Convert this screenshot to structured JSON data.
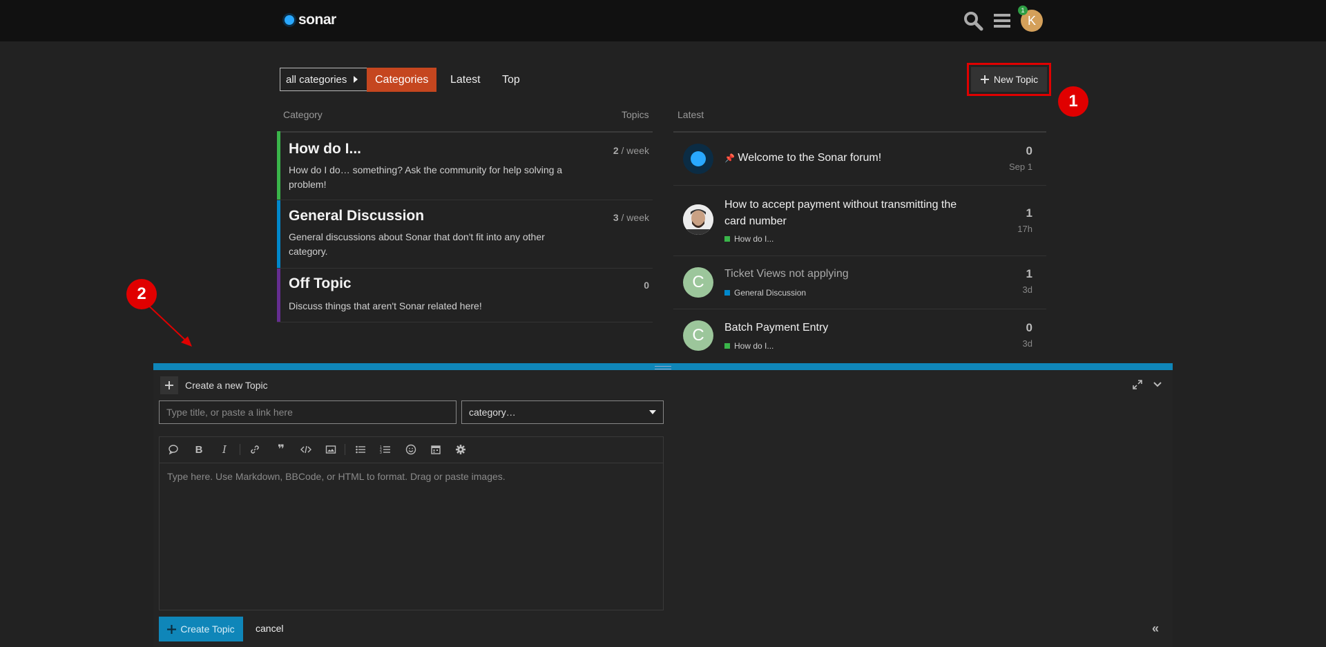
{
  "header": {
    "logo_text": "sonar",
    "avatar_letter": "K",
    "notification_count": "1",
    "icons": [
      "search-icon",
      "hamburger-menu-icon"
    ]
  },
  "nav": {
    "category_dropdown": "all categories",
    "tabs": [
      "Categories",
      "Latest",
      "Top"
    ],
    "new_topic_label": "New Topic"
  },
  "annotations": {
    "one": "1",
    "two": "2"
  },
  "categories_table": {
    "col_category": "Category",
    "col_topics": "Topics",
    "rows": [
      {
        "title": "How do I...",
        "description": "How do I do… something? Ask the community for help solving a problem!",
        "count": "2",
        "unit": " / week",
        "color": "#3ab54a"
      },
      {
        "title": "General Discussion",
        "description": "General discussions about Sonar that don't fit into any other category.",
        "count": "3",
        "unit": " / week",
        "color": "#0088cc"
      },
      {
        "title": "Off Topic",
        "description": "Discuss things that aren't Sonar related here!",
        "count": "0",
        "unit": "",
        "color": "#652d90"
      }
    ]
  },
  "latest": {
    "col_latest": "Latest",
    "topics": [
      {
        "title": "Welcome to the Sonar forum!",
        "pinned": true,
        "category": "",
        "count": "0",
        "time": "Sep 1"
      },
      {
        "title": "How to accept payment without transmitting the card number",
        "category": "How do I...",
        "category_color": "#3ab54a",
        "count": "1",
        "time": "17h"
      },
      {
        "title": "Ticket Views not applying",
        "category": "General Discussion",
        "category_color": "#0088cc",
        "count": "1",
        "time": "3d",
        "avatar_letter": "C"
      },
      {
        "title": "Batch Payment Entry",
        "category": "How do I...",
        "category_color": "#3ab54a",
        "count": "0",
        "time": "3d",
        "avatar_letter": "C"
      }
    ]
  },
  "composer": {
    "heading": "Create a new Topic",
    "title_placeholder": "Type title, or paste a link here",
    "category_placeholder": "category…",
    "body_placeholder": "Type here. Use Markdown, BBCode, or HTML to format. Drag or paste images.",
    "submit_label": "Create Topic",
    "cancel_label": "cancel",
    "toolbar_icons": [
      "quote-bubble-icon",
      "bold-icon",
      "italic-icon",
      "link-icon",
      "blockquote-icon",
      "code-icon",
      "image-icon",
      "bullet-list-icon",
      "numbered-list-icon",
      "emoji-icon",
      "calendar-icon",
      "gear-icon"
    ]
  },
  "colors": {
    "accent": "#0f86b9",
    "active_tab": "#c5461f",
    "annotation": "#e00000"
  }
}
